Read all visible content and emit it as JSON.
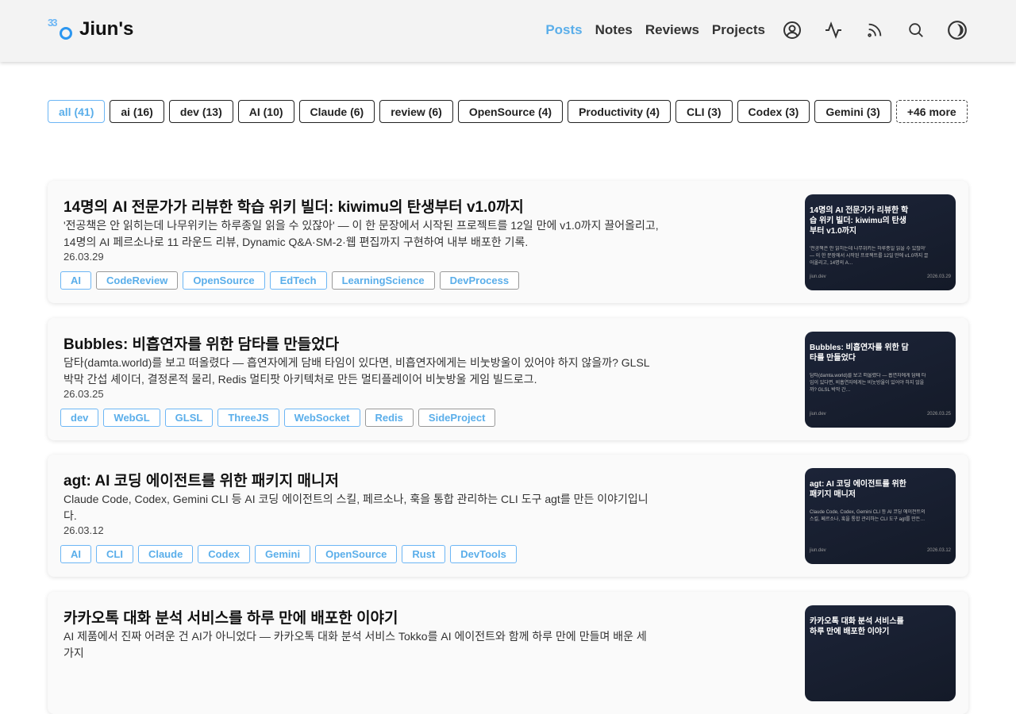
{
  "header": {
    "brand": "Jiun's",
    "logo_text": "33",
    "nav": [
      "Posts",
      "Notes",
      "Reviews",
      "Projects"
    ],
    "active": "Posts",
    "icons": [
      "user-circle-icon",
      "activity-icon",
      "rss-icon",
      "search-icon",
      "theme-toggle-icon"
    ]
  },
  "filters": [
    "all (41)",
    "ai (16)",
    "dev (13)",
    "AI (10)",
    "Claude (6)",
    "review (6)",
    "OpenSource (4)",
    "Productivity (4)",
    "CLI (3)",
    "Codex (3)",
    "Gemini (3)"
  ],
  "filters_more": "+46 more",
  "posts": [
    {
      "title": "14명의 AI 전문가가 리뷰한 학습 위키 빌더: kiwimu의 탄생부터 v1.0까지",
      "desc": "'전공책은 안 읽히는데 나무위키는 하루종일 읽을 수 있잖아' — 이 한 문장에서 시작된 프로젝트를 12일 만에 v1.0까지 끌어올리고, 14명의 AI 페르소나로 11 라운드 리뷰, Dynamic Q&A·SM-2·웹 편집까지 구현하여 내부 배포한 기록.",
      "date": "26.03.29",
      "tags": [
        "AI",
        "CodeReview",
        "OpenSource",
        "EdTech",
        "LearningScience",
        "DevProcess"
      ],
      "thumb": {
        "title": "14명의 AI 전문가가 리뷰한 학습 위키 빌더: kiwimu의 탄생부터 v1.0까지",
        "excerpt": "'전공책은 안 읽히는데 나무위키는 하루종일 읽을 수 있잖아' — 이 한 문장에서 시작된 프로젝트를 12일 만에 v1.0까지 끌어올리고, 14명의 A…",
        "site": "jiun.dev",
        "date": "2026.03.29"
      }
    },
    {
      "title": "Bubbles: 비흡연자를 위한 담타를 만들었다",
      "desc": "담타(damta.world)를 보고 떠올렸다 — 흡연자에게 담배 타임이 있다면, 비흡연자에게는 비눗방울이 있어야 하지 않을까? GLSL 박막 간섭 셰이더, 결정론적 물리, Redis 멀티팟 아키텍처로 만든 멀티플레이어 비눗방울 게임 빌드로그.",
      "date": "26.03.25",
      "tags": [
        "dev",
        "WebGL",
        "GLSL",
        "ThreeJS",
        "WebSocket",
        "Redis",
        "SideProject"
      ],
      "thumb": {
        "title": "Bubbles: 비흡연자를 위한 담타를 만들었다",
        "excerpt": "담타(damta.world)를 보고 떠올렸다 — 흡연자에게 담배 타임이 있다면, 비흡연자에게는 비눗방울이 있어야 하지 않을까? GLSL 박막 간…",
        "site": "jiun.dev",
        "date": "2026.03.25"
      }
    },
    {
      "title": "agt: AI 코딩 에이전트를 위한 패키지 매니저",
      "desc": "Claude Code, Codex, Gemini CLI 등 AI 코딩 에이전트의 스킬, 페르소나, 훅을 통합 관리하는 CLI 도구 agt를 만든 이야기입니다.",
      "date": "26.03.12",
      "tags": [
        "AI",
        "CLI",
        "Claude",
        "Codex",
        "Gemini",
        "OpenSource",
        "Rust",
        "DevTools"
      ],
      "thumb": {
        "title": "agt: AI 코딩 에이전트를 위한 패키지 매니저",
        "excerpt": "Claude Code, Codex, Gemini CLI 등 AI 코딩 에이전트의 스킬, 페르소나, 훅을 통합 관리하는 CLI 도구 agt를 만든…",
        "site": "jiun.dev",
        "date": "2026.03.12"
      }
    },
    {
      "title": "카카오톡 대화 분석 서비스를 하루 만에 배포한 이야기",
      "desc": "AI 제품에서 진짜 어려운 건 AI가 아니었다 — 카카오톡 대화 분석 서비스 Tokko를 AI 에이전트와 함께 하루 만에 만들며 배운 세 가지",
      "date": "",
      "tags": [],
      "thumb": {
        "title": "카카오톡 대화 분석 서비스를 하루 만에 배포한 이야기",
        "excerpt": "",
        "site": "",
        "date": ""
      }
    }
  ]
}
